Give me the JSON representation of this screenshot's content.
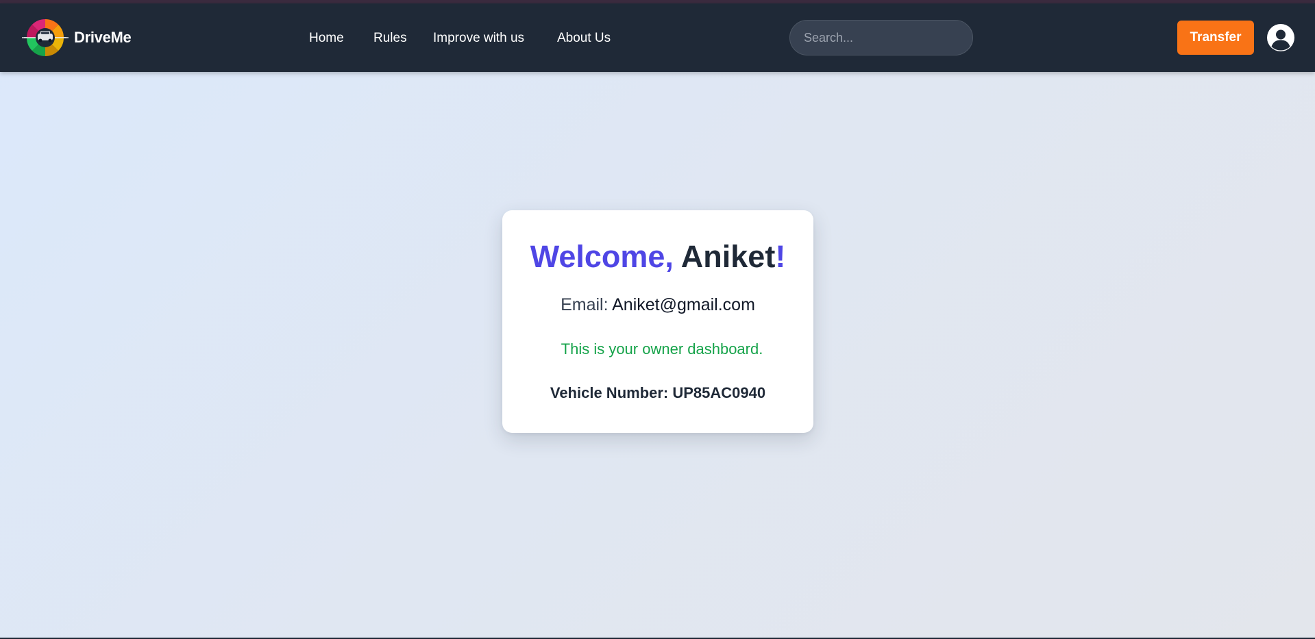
{
  "brand": {
    "name": "DriveMe",
    "logo_icon": "steering-wheel-car-icon"
  },
  "nav": {
    "links": [
      {
        "label": "Home"
      },
      {
        "label": "Rules"
      },
      {
        "label": "Improve with us"
      },
      {
        "label": "About Us"
      }
    ]
  },
  "search": {
    "placeholder": "Search...",
    "value": ""
  },
  "transfer": {
    "label": "Transfer"
  },
  "profile": {
    "icon": "user-circle-icon"
  },
  "card": {
    "welcome_prefix": "Welcome,",
    "user_name": "Aniket",
    "welcome_suffix": "!",
    "email_label": "Email:",
    "email_value": "Aniket@gmail.com",
    "dashboard_message": "This is your owner dashboard.",
    "vehicle_text": "Vehicle Number: UP85AC0940"
  },
  "colors": {
    "navbar": "#1f2937",
    "accent": "#4f46e5",
    "button": "#f97316",
    "success": "#16a34a"
  }
}
